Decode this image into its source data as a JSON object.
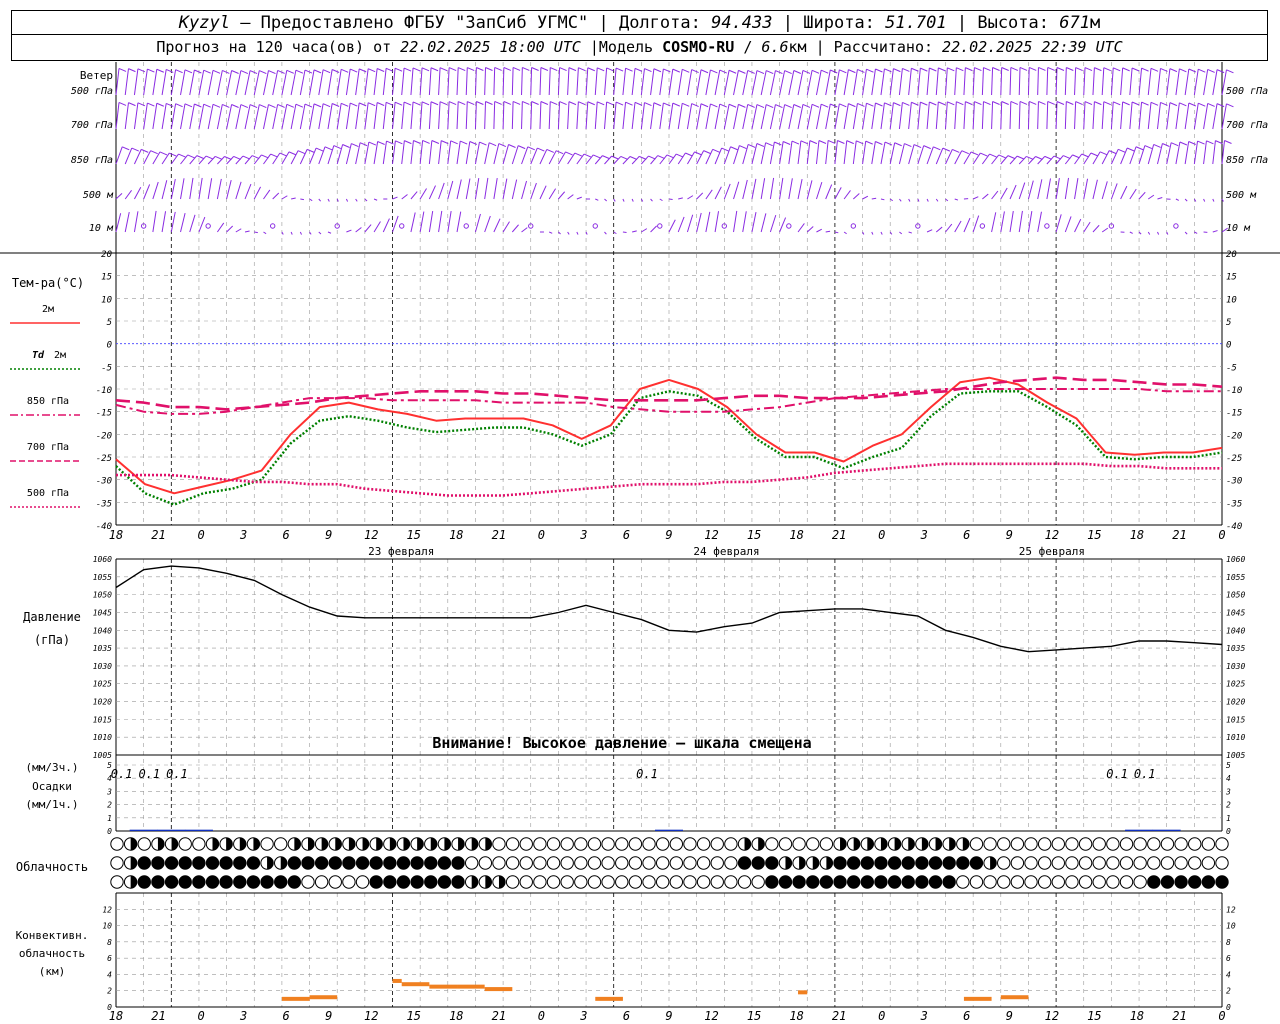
{
  "header": {
    "station": "Kyzyl",
    "provided_label": "– Предоставлено ФГБУ \"ЗапСиб УГМС\"",
    "lon_label": "Долгота:",
    "lon_value": "94.433",
    "lat_label": "Широта:",
    "lat_value": "51.701",
    "alt_label": "Высота:",
    "alt_value": "671",
    "alt_unit": "м",
    "sep": "|"
  },
  "subheader": {
    "forecast_label": "Прогноз на 120 часа(ов) от",
    "forecast_start": "22.02.2025 18:00 UTC",
    "model_label": "Модель",
    "model_name": "COSMO-RU",
    "model_res": "6.6",
    "model_res_unit": "км",
    "calc_label": "Рассчитано:",
    "calc_time": "22.02.2025 22:39 UTC",
    "sep": "|"
  },
  "time_axis": {
    "hours": [
      "18",
      "21",
      "0",
      "3",
      "6",
      "9",
      "12",
      "15",
      "18",
      "21",
      "0",
      "3",
      "6",
      "9",
      "12",
      "15",
      "18",
      "21",
      "0",
      "3",
      "6",
      "9",
      "12",
      "15",
      "18",
      "21",
      "0"
    ],
    "dates": [
      {
        "label": "23 февраля",
        "index": 6
      },
      {
        "label": "24 февраля",
        "index": 14
      },
      {
        "label": "25 февраля",
        "index": 22
      }
    ]
  },
  "wind": {
    "title": "Ветер",
    "levels": [
      "500 гПа",
      "700 гПа",
      "850 гПа",
      "500 м",
      "10 м"
    ]
  },
  "temperature": {
    "title": "Тем-ра(°C)",
    "ylim": [
      -40,
      20
    ],
    "ticks": [
      20,
      15,
      10,
      5,
      0,
      -5,
      -10,
      -15,
      -20,
      -25,
      -30,
      -35,
      -40
    ],
    "legend": [
      {
        "label": "2м",
        "color": "#ff3030",
        "style": "solid"
      },
      {
        "label": "Td 2м",
        "color": "#008000",
        "style": "dotted"
      },
      {
        "label": "850 гПа",
        "color": "#e0106a",
        "style": "dashdot"
      },
      {
        "label": "700 гПа",
        "color": "#e0106a",
        "style": "dashed"
      },
      {
        "label": "500 гПа",
        "color": "#e0106a",
        "style": "dotted"
      }
    ]
  },
  "pressure": {
    "title": "Давление",
    "unit": "(гПа)",
    "ylim": [
      1005,
      1060
    ],
    "ticks": [
      1060,
      1055,
      1050,
      1045,
      1040,
      1035,
      1030,
      1025,
      1020,
      1015,
      1010,
      1005
    ],
    "warning": "Внимание! Высокое давление – шкала смещена"
  },
  "precip": {
    "label1": "(мм/3ч.)",
    "label2": "Осадки",
    "label3": "(мм/1ч.)",
    "ylim": [
      0,
      5
    ],
    "ticks": [
      5,
      4,
      3,
      2,
      1,
      0
    ],
    "annotations": [
      {
        "hour": 3,
        "text": "0.1"
      },
      {
        "hour": 6,
        "text": "0.1"
      },
      {
        "hour": 9,
        "text": "0.1"
      },
      {
        "hour": 60,
        "text": "0.1"
      },
      {
        "hour": 111,
        "text": "0.1"
      },
      {
        "hour": 114,
        "text": "0.1"
      }
    ]
  },
  "clouds": {
    "title": "Облачность"
  },
  "convective": {
    "title1": "Конвективн.",
    "title2": "облачность",
    "title3": "(км)",
    "ylim": [
      0,
      14
    ],
    "ticks": [
      12,
      10,
      8,
      6,
      4,
      2,
      0
    ]
  },
  "colors": {
    "wind": "#8a2be2",
    "t2m": "#ff3030",
    "td2m": "#008000",
    "pmag": "#e0106a",
    "zero_line": "#4040ff",
    "grid": "#999999",
    "pressure": "#000000",
    "precip": "#1030c0",
    "convective": "#f08020"
  },
  "chart_data": [
    {
      "type": "line",
      "title": "Тем-ра(°C)",
      "x_hours": [
        0,
        3,
        6,
        9,
        12,
        15,
        18,
        21,
        24,
        27,
        30,
        33,
        36,
        39,
        42,
        45,
        48,
        51,
        54,
        57,
        60,
        63,
        66,
        69,
        72,
        75,
        78,
        81,
        84,
        87,
        90,
        93,
        96,
        99,
        102,
        105,
        108,
        111,
        114,
        117,
        120
      ],
      "ylim": [
        -40,
        20
      ],
      "series": [
        {
          "name": "2м",
          "values": [
            -25.5,
            -31,
            -33,
            -31.5,
            -30,
            -28,
            -20,
            -14,
            -13,
            -14.5,
            -15.5,
            -17,
            -16.5,
            -16.5,
            -16.5,
            -18,
            -21,
            -18,
            -10,
            -8,
            -10,
            -14,
            -20,
            -24,
            -24,
            -26,
            -22.5,
            -20,
            -14,
            -8.5,
            -7.5,
            -9,
            -13,
            -16.5,
            -24,
            -24.5,
            -24,
            -24,
            -23
          ]
        },
        {
          "name": "Td 2м",
          "values": [
            -27,
            -33,
            -35.5,
            -33,
            -32,
            -30,
            -22,
            -17,
            -16,
            -17,
            -18.5,
            -19.5,
            -19,
            -18.5,
            -18.5,
            -20,
            -22.5,
            -20,
            -12,
            -10.5,
            -11.5,
            -15,
            -21,
            -25,
            -25,
            -27.5,
            -25,
            -23,
            -16,
            -11,
            -10.5,
            -10.5,
            -14,
            -18,
            -25,
            -25.5,
            -25,
            -25,
            -24
          ]
        },
        {
          "name": "850 гПа",
          "values": [
            -13.5,
            -15,
            -15.5,
            -15.5,
            -15,
            -14,
            -13,
            -12,
            -12,
            -12,
            -12.5,
            -12.5,
            -12.5,
            -12.5,
            -13,
            -13,
            -13,
            -13,
            -14,
            -14.5,
            -15,
            -15,
            -15,
            -14.5,
            -14,
            -13,
            -12,
            -11.5,
            -11,
            -10.5,
            -10,
            -10,
            -10,
            -10,
            -10,
            -10,
            -10,
            -10,
            -10.5,
            -10.5,
            -10.5
          ]
        },
        {
          "name": "700 гПа",
          "values": [
            -12.5,
            -13,
            -14,
            -14,
            -14.5,
            -14,
            -13.5,
            -13,
            -12,
            -11.5,
            -11,
            -10.5,
            -10.5,
            -10.5,
            -11,
            -11,
            -11.5,
            -12,
            -12.5,
            -12.5,
            -12.5,
            -12.5,
            -12,
            -11.5,
            -11.5,
            -12,
            -12,
            -12,
            -11.5,
            -11,
            -10.5,
            -9.5,
            -8.5,
            -8,
            -7.5,
            -8,
            -8,
            -8.5,
            -9,
            -9,
            -9.5
          ]
        },
        {
          "name": "500 гПа",
          "values": [
            -29,
            -29,
            -29,
            -29.5,
            -30,
            -30.5,
            -30.5,
            -31,
            -31,
            -32,
            -32.5,
            -33,
            -33.5,
            -33.5,
            -33.5,
            -33,
            -32.5,
            -32,
            -31.5,
            -31,
            -31,
            -31,
            -30.5,
            -30.5,
            -30,
            -29.5,
            -28.5,
            -28,
            -27.5,
            -27,
            -26.5,
            -26.5,
            -26.5,
            -26.5,
            -26.5,
            -26.5,
            -27,
            -27,
            -27.5,
            -27.5,
            -27.5
          ]
        }
      ]
    },
    {
      "type": "line",
      "title": "Давление",
      "ylabel": "(гПа)",
      "x_hours": [
        0,
        3,
        6,
        9,
        12,
        15,
        18,
        21,
        24,
        27,
        30,
        33,
        36,
        39,
        42,
        45,
        48,
        51,
        54,
        57,
        60,
        63,
        66,
        69,
        72,
        75,
        78,
        81,
        84,
        87,
        90,
        93,
        96,
        99,
        102,
        105,
        108,
        111,
        114,
        117,
        120
      ],
      "ylim": [
        1005,
        1060
      ],
      "series": [
        {
          "name": "",
          "values": [
            1052,
            1057,
            1058,
            1057.5,
            1056,
            1054,
            1050,
            1046.5,
            1044,
            1043.5,
            1043.5,
            1043.5,
            1043.5,
            1043.5,
            1043.5,
            1043.5,
            1045,
            1047,
            1045,
            1043,
            1040,
            1039.5,
            1041,
            1042,
            1045,
            1045.5,
            1046,
            1046,
            1045,
            1044,
            1040,
            1038,
            1035.5,
            1034,
            1034.5,
            1035,
            1035.5,
            1037,
            1037,
            1036.5,
            1036
          ]
        }
      ]
    },
    {
      "type": "bar",
      "title": "Осадки",
      "ylabel": "(мм/3ч.)",
      "x_hours": [
        3,
        6,
        9,
        60,
        111,
        114
      ],
      "ylim": [
        0,
        5
      ],
      "series": [
        {
          "name": "",
          "values": [
            0.1,
            0.1,
            0.1,
            0.1,
            0.1,
            0.1
          ]
        }
      ]
    },
    {
      "type": "bar",
      "title": "Конвективн. облачность",
      "ylabel": "(км)",
      "ylim": [
        0,
        14
      ],
      "segments": [
        {
          "x0": 18,
          "x1": 21,
          "base": 0,
          "top": 1
        },
        {
          "x0": 21,
          "x1": 24,
          "base": 0,
          "top": 1.2
        },
        {
          "x0": 30,
          "x1": 31,
          "base": 0,
          "top": 3.2
        },
        {
          "x0": 31,
          "x1": 34,
          "base": 0,
          "top": 2.8
        },
        {
          "x0": 34,
          "x1": 37,
          "base": 0,
          "top": 2.5
        },
        {
          "x0": 37,
          "x1": 40,
          "base": 0,
          "top": 2.5
        },
        {
          "x0": 40,
          "x1": 43,
          "base": 0,
          "top": 2.2
        },
        {
          "x0": 52,
          "x1": 55,
          "base": 0,
          "top": 1
        },
        {
          "x0": 74,
          "x1": 75,
          "base": 0,
          "top": 1.8
        },
        {
          "x0": 92,
          "x1": 95,
          "base": 0,
          "top": 1
        },
        {
          "x0": 96,
          "x1": 99,
          "base": 0,
          "top": 1.2
        }
      ]
    },
    {
      "type": "table",
      "title": "Облачность",
      "rows": [
        "ububbuubbbbuubbbbbbbbbbbbbbbuuuuuuuuuuuuuuuuuubbuuuuubbbbbbbbbbuuuuuuuuuuuuuuuuuuu",
        "ubfffffffffbbfffffffffffffuuuuuuuuuuuuuuuuuuuufffbbbbfffffffffffbuuuuuuuuuuuuuuuuu",
        "ubffffffffffffuuuuufffffffbbbuuuuuuuuuuuuuuuuuuuffffffffffffffuuuuuuuuuuuuuuffffff"
      ]
    }
  ]
}
